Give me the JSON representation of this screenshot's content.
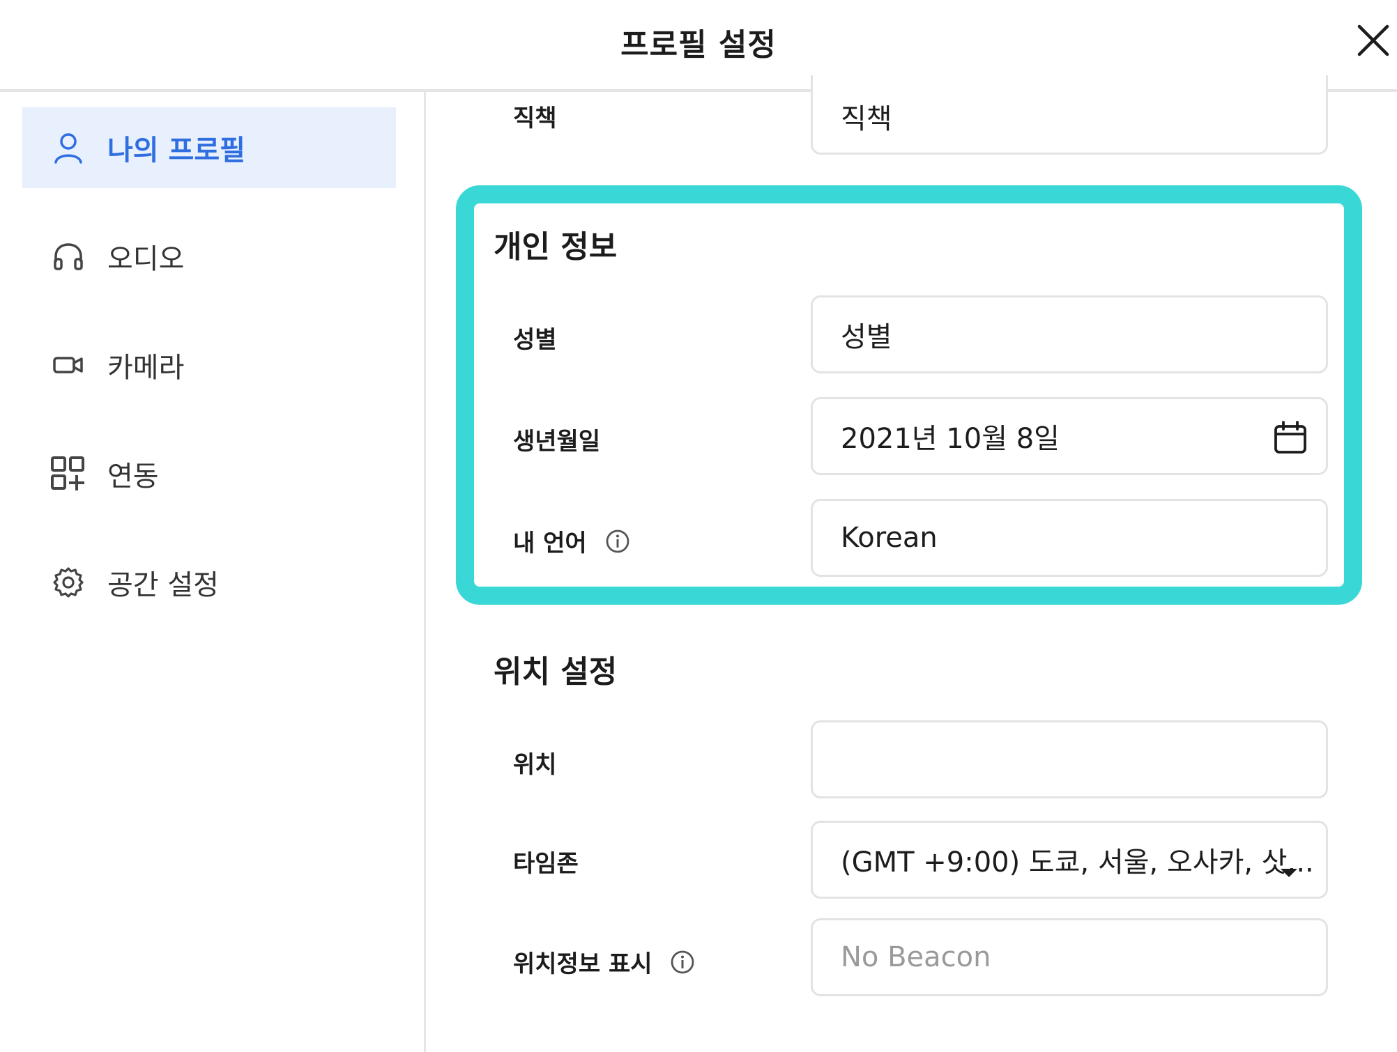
{
  "header": {
    "title": "프로필 설정"
  },
  "sidebar": {
    "items": [
      {
        "label": "나의 프로필",
        "icon": "user-icon",
        "active": true
      },
      {
        "label": "오디오",
        "icon": "headphones-icon"
      },
      {
        "label": "카메라",
        "icon": "camera-icon"
      },
      {
        "label": "연동",
        "icon": "apps-add-icon"
      },
      {
        "label": "공간 설정",
        "icon": "gear-icon"
      }
    ]
  },
  "content": {
    "job_title": {
      "label": "직책",
      "value": "직책"
    },
    "personal": {
      "title": "개인 정보",
      "gender": {
        "label": "성별",
        "value": "성별"
      },
      "birthday": {
        "label": "생년월일",
        "value": "2021년 10월 8일"
      },
      "language": {
        "label": "내 언어",
        "value": "Korean"
      }
    },
    "location_settings": {
      "title": "위치 설정",
      "location": {
        "label": "위치",
        "value": ""
      },
      "timezone": {
        "label": "타임존",
        "value": "(GMT +9:00) 도쿄, 서울, 오사카, 삿..."
      },
      "beacon": {
        "label": "위치정보 표시",
        "placeholder": "No Beacon"
      }
    }
  },
  "colors": {
    "accent": "#2f6ee0",
    "highlight": "#39d8d6",
    "active_bg": "#e8f0fd"
  }
}
